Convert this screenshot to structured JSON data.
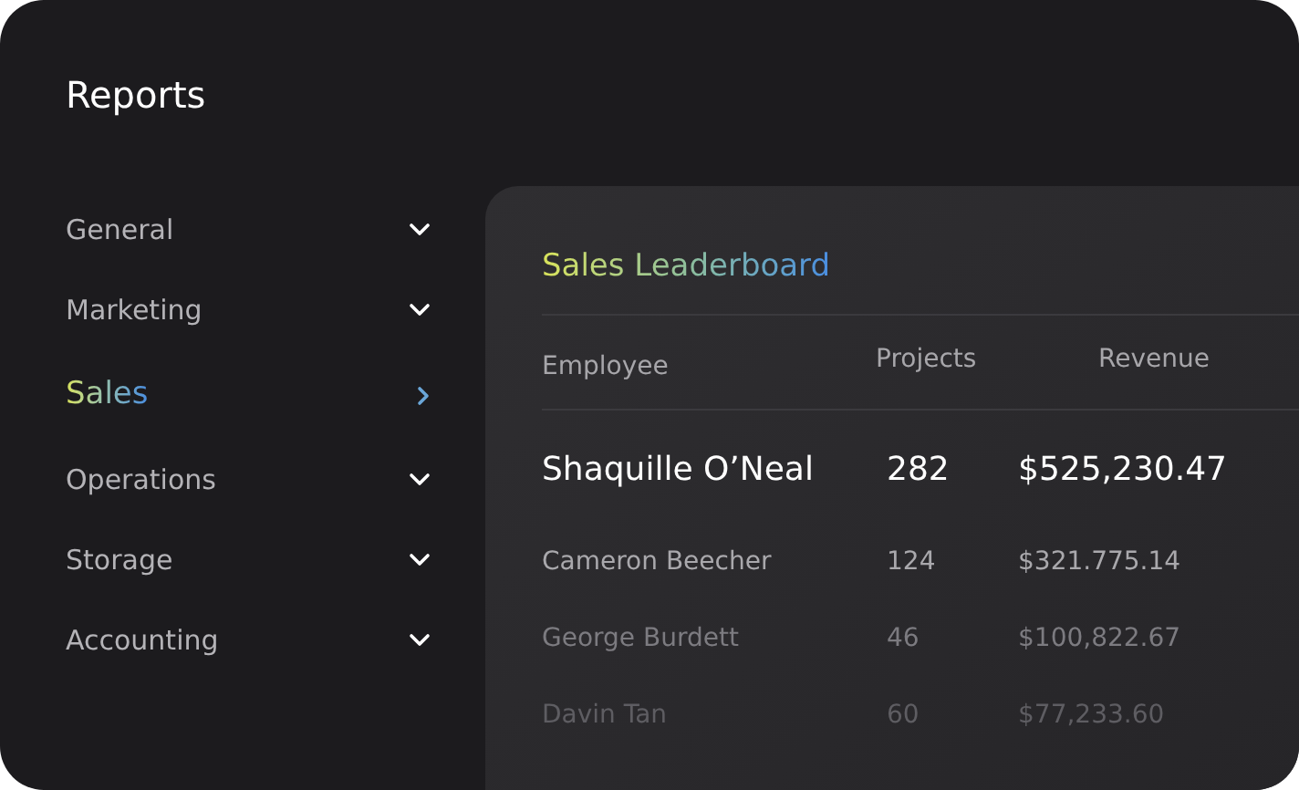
{
  "sidebar": {
    "title": "Reports",
    "items": [
      {
        "label": "General",
        "selected": false
      },
      {
        "label": "Marketing",
        "selected": false
      },
      {
        "label": "Sales",
        "selected": true
      },
      {
        "label": "Operations",
        "selected": false
      },
      {
        "label": "Storage",
        "selected": false
      },
      {
        "label": "Accounting",
        "selected": false
      }
    ]
  },
  "leaderboard": {
    "title": "Sales Leaderboard",
    "columns": [
      "Employee",
      "Projects",
      "Revenue"
    ],
    "rows": [
      {
        "kind": "featured",
        "employee": "Shaquille O’Neal",
        "projects": "282",
        "revenue": "$525,230.47"
      },
      {
        "kind": "standard",
        "employee": "Cameron Beecher",
        "projects": "124",
        "revenue": "$321.775.14"
      },
      {
        "kind": "standard",
        "employee": "George Burdett",
        "projects": "46",
        "revenue": "$100,822.67"
      },
      {
        "kind": "standard",
        "employee": "Davin Tan",
        "projects": "60",
        "revenue": "$77,233.60"
      }
    ]
  }
}
